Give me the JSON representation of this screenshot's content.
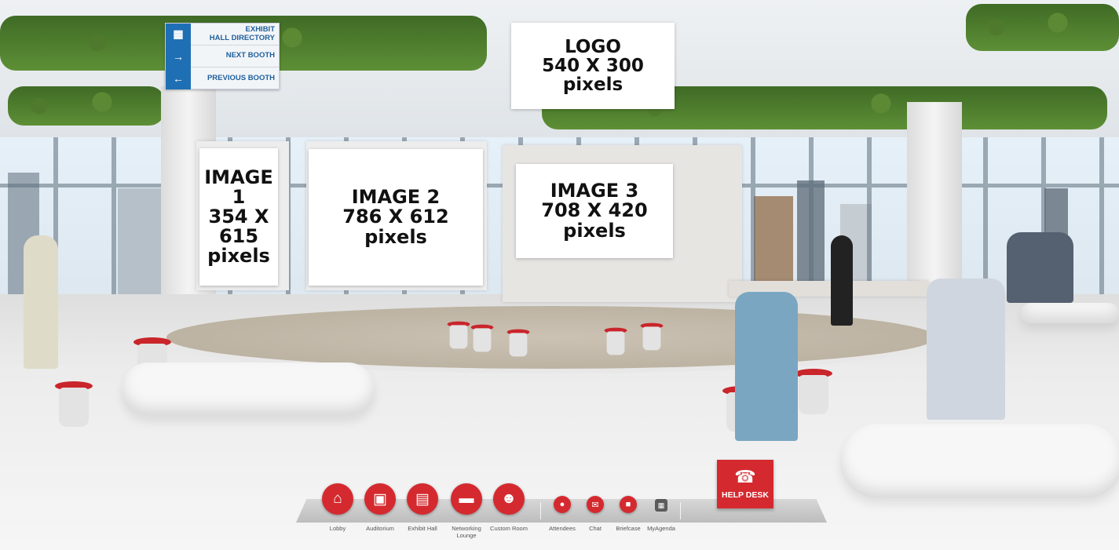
{
  "nav_panel": {
    "items": [
      {
        "icon": "grid-icon",
        "label": "EXHIBIT\nHALL DIRECTORY"
      },
      {
        "icon": "arrow-right-icon",
        "label": "NEXT BOOTH"
      },
      {
        "icon": "arrow-left-icon",
        "label": "PREVIOUS BOOTH"
      }
    ]
  },
  "boards": {
    "logo": {
      "line1": "LOGO",
      "line2": "540 X 300",
      "line3": "pixels"
    },
    "image1": {
      "line1": "IMAGE 1",
      "line2": "354 X 615",
      "line3": "pixels"
    },
    "image2": {
      "line1": "IMAGE 2",
      "line2": "786 X 612",
      "line3": "pixels"
    },
    "image3": {
      "line1": "IMAGE 3",
      "line2": "708 X 420",
      "line3": "pixels"
    }
  },
  "dock": {
    "primary": [
      {
        "label": "Lobby",
        "icon": "home-icon"
      },
      {
        "label": "Auditorium",
        "icon": "auditorium-icon"
      },
      {
        "label": "Exhibit Hall",
        "icon": "exhibit-hall-icon"
      },
      {
        "label": "Networking Lounge",
        "icon": "sofa-icon"
      },
      {
        "label": "Custom Room",
        "icon": "people-icon"
      }
    ],
    "secondary": [
      {
        "label": "Attendees",
        "icon": "user-icon"
      },
      {
        "label": "Chat",
        "icon": "chat-icon"
      },
      {
        "label": "Briefcase",
        "icon": "briefcase-icon"
      },
      {
        "label": "MyAgenda",
        "icon": "calendar-icon"
      }
    ]
  },
  "help_desk": {
    "label": "HELP DESK",
    "icon": "support-agent-icon"
  },
  "colors": {
    "accent": "#d42a2f",
    "nav_blue": "#1f6fb5"
  }
}
